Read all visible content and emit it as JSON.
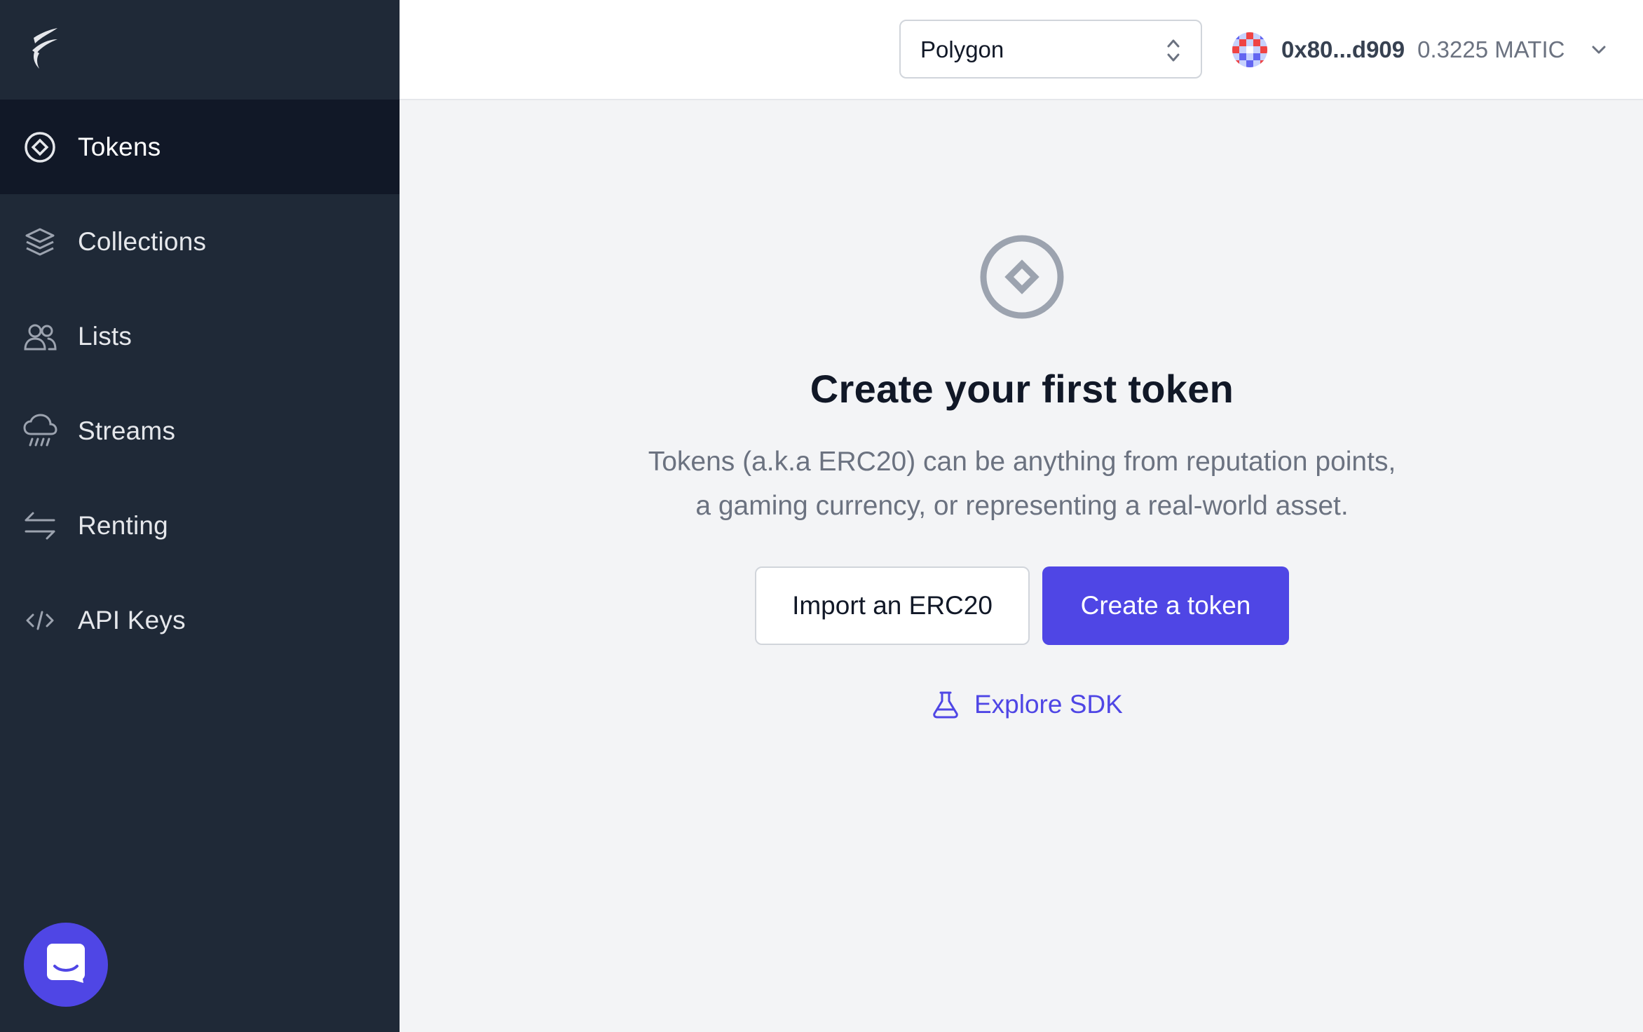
{
  "colors": {
    "sidebar_bg": "#1f2937",
    "sidebar_active_bg": "#111827",
    "accent": "#4f46e5",
    "page_bg": "#f3f4f6"
  },
  "sidebar": {
    "logo_icon": "flame-logo-icon",
    "items": [
      {
        "label": "Tokens",
        "icon": "token-diamond-icon",
        "active": true
      },
      {
        "label": "Collections",
        "icon": "layers-icon",
        "active": false
      },
      {
        "label": "Lists",
        "icon": "users-icon",
        "active": false
      },
      {
        "label": "Streams",
        "icon": "cloud-rain-icon",
        "active": false
      },
      {
        "label": "Renting",
        "icon": "switch-arrows-icon",
        "active": false
      },
      {
        "label": "API Keys",
        "icon": "code-icon",
        "active": false
      }
    ],
    "chat_icon": "chat-bubble-icon"
  },
  "header": {
    "network": {
      "selected": "Polygon"
    },
    "wallet": {
      "address": "0x80...d909",
      "balance": "0.3225 MATIC"
    }
  },
  "empty_state": {
    "icon": "token-diamond-icon",
    "title": "Create your first token",
    "description_line1": "Tokens (a.k.a ERC20) can be anything from reputation points,",
    "description_line2": "a gaming currency, or representing a real-world asset.",
    "import_button": "Import an ERC20",
    "create_button": "Create a token",
    "sdk_link": "Explore SDK"
  }
}
